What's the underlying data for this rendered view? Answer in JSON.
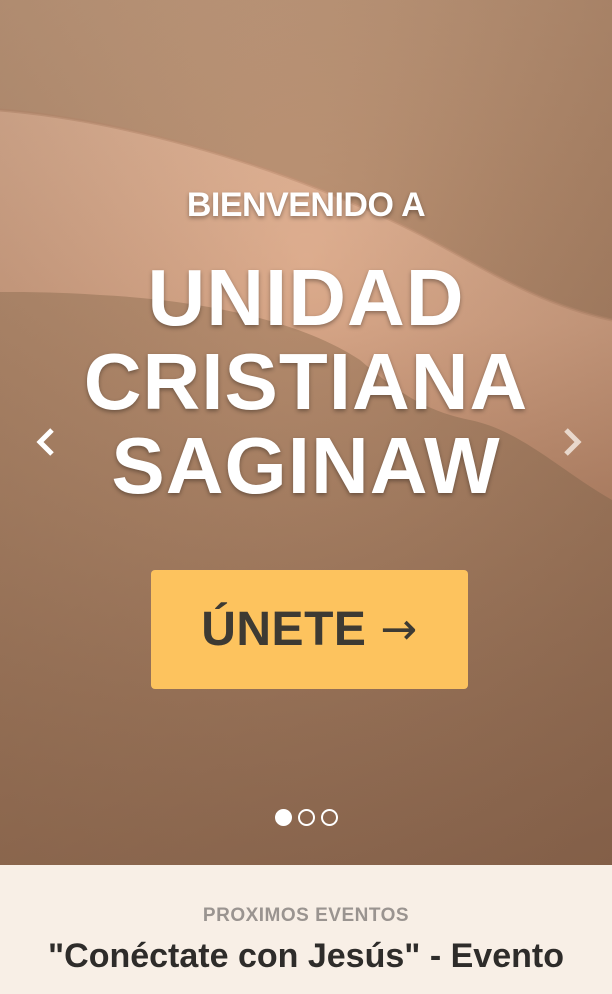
{
  "hero": {
    "eyebrow": "BIENVENIDO A",
    "title_lines": [
      "UNIDAD",
      "CRISTIANA",
      "SAGINAW"
    ],
    "cta_label": "ÚNETE",
    "cta_arrow": "→",
    "prev_icon": "chevron-left-icon",
    "next_icon": "chevron-right-icon",
    "cta_color": "#fdc35e",
    "slides": {
      "count": 3,
      "active": 1
    }
  },
  "events": {
    "eyebrow": "PROXIMOS EVENTOS",
    "title": "\"Conéctate con Jesús\" - Evento"
  }
}
